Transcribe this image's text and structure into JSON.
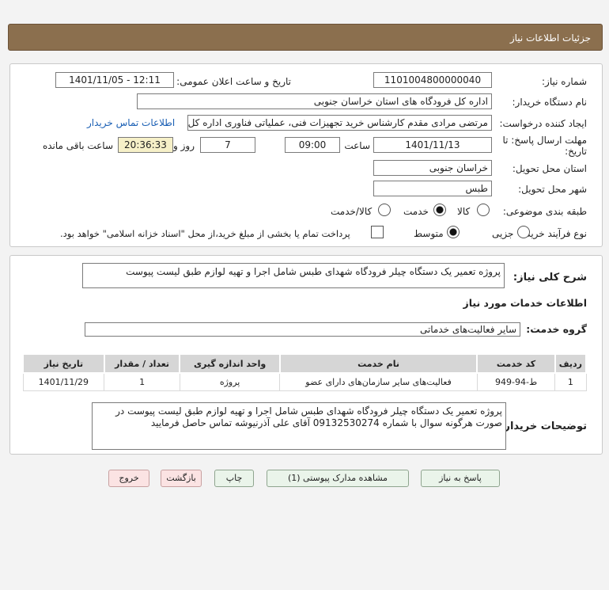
{
  "header": {
    "title": "جزئیات اطلاعات نیاز"
  },
  "form": {
    "need_number_label": "شماره نیاز:",
    "need_number": "1101004800000040",
    "announce_label": "تاریخ و ساعت اعلان عمومی:",
    "announce_value": "1401/11/05 - 12:11",
    "buyer_org_label": "نام دستگاه خریدار:",
    "buyer_org": "اداره کل فرودگاه های استان خراسان جنوبی",
    "creator_label": "ایجاد کننده درخواست:",
    "creator": "مرتضی مرادی مقدم کارشناس خرید تجهیزات فنی، عملیاتی فناوری اداره کل فرو",
    "contact_link": "اطلاعات تماس خریدار",
    "deadline_label_1": "مهلت ارسال پاسخ: تا",
    "deadline_label_2": "تاریخ:",
    "deadline_date": "1401/11/13",
    "time_label": "ساعت",
    "deadline_time": "09:00",
    "days_value": "7",
    "days_label": "روز و",
    "remaining_time": "20:36:33",
    "remaining_label": "ساعت باقی مانده",
    "province_label": "استان محل تحویل:",
    "province": "خراسان جنوبی",
    "city_label": "شهر محل تحویل:",
    "city": "طبس",
    "category_label": "طبقه بندی موضوعی:",
    "category_options": [
      "کالا",
      "خدمت",
      "کالا/خدمت"
    ],
    "category_selected": "خدمت",
    "process_label": "نوع فرآیند خرید :",
    "process_options": [
      "جزیی",
      "متوسط"
    ],
    "process_selected": "متوسط",
    "payment_note": "پرداخت تمام یا بخشی از مبلغ خرید،از محل \"اسناد خزانه اسلامی\" خواهد بود."
  },
  "details": {
    "summary_label": "شرح کلی نیاز:",
    "summary": "پروژه تعمیر یک دستگاه چیلر فرودگاه شهدای طبس شامل اجرا و تهیه لوازم طبق لیست پیوست",
    "services_heading": "اطلاعات خدمات مورد نیاز",
    "service_group_label": "گروه خدمت:",
    "service_group": "سایر فعالیت‌های خدماتی",
    "table": {
      "headers": [
        "ردیف",
        "کد خدمت",
        "نام خدمت",
        "واحد اندازه گیری",
        "تعداد / مقدار",
        "تاریخ نیاز"
      ],
      "rows": [
        [
          "1",
          "ط-94-949",
          "فعالیت‌های سایر سازمان‌های دارای عضو",
          "پروژه",
          "1",
          "1401/11/29"
        ]
      ]
    },
    "buyer_notes_label": "توضیحات خریدار:",
    "buyer_notes": "پروژه تعمیر یک دستگاه چیلر فرودگاه شهدای طبس شامل اجرا و تهیه لوازم طبق لیست پیوست در صورت هرگونه سوال با شماره 09132530274 آقای علی آذرنیوشه تماس حاصل فرمایید"
  },
  "buttons": {
    "reply": "پاسخ به نیاز",
    "attachments": "مشاهده مدارک پیوستی (1)",
    "print": "چاپ",
    "back": "بازگشت",
    "exit": "خروج"
  },
  "colors": {
    "header_bg": "#8b6f4e",
    "button_bg": "#eaf4ea",
    "exit_bg": "#fbe3e3",
    "link": "#1a5fb4"
  }
}
